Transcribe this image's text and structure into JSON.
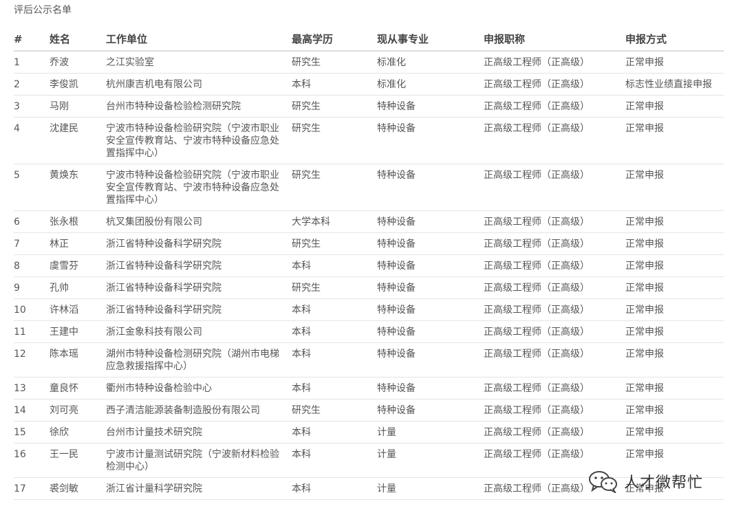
{
  "title": "评后公示名单",
  "columns": [
    "#",
    "姓名",
    "工作单位",
    "最高学历",
    "现从事专业",
    "申报职称",
    "申报方式"
  ],
  "rows": [
    {
      "no": "1",
      "name": "乔波",
      "unit": "之江实验室",
      "edu": "研究生",
      "major": "标准化",
      "title": "正高级工程师（正高级）",
      "method": "正常申报"
    },
    {
      "no": "2",
      "name": "李俊凯",
      "unit": "杭州康吉机电有限公司",
      "edu": "本科",
      "major": "标准化",
      "title": "正高级工程师（正高级）",
      "method": "标志性业绩直接申报"
    },
    {
      "no": "3",
      "name": "马刚",
      "unit": "台州市特种设备检验检测研究院",
      "edu": "研究生",
      "major": "特种设备",
      "title": "正高级工程师（正高级）",
      "method": "正常申报"
    },
    {
      "no": "4",
      "name": "沈建民",
      "unit": "宁波市特种设备检验研究院（宁波市职业安全宣传教育站、宁波市特种设备应急处置指挥中心）",
      "edu": "研究生",
      "major": "特种设备",
      "title": "正高级工程师（正高级）",
      "method": "正常申报"
    },
    {
      "no": "5",
      "name": "黄焕东",
      "unit": "宁波市特种设备检验研究院（宁波市职业安全宣传教育站、宁波市特种设备应急处置指挥中心）",
      "edu": "研究生",
      "major": "特种设备",
      "title": "正高级工程师（正高级）",
      "method": "正常申报"
    },
    {
      "no": "6",
      "name": "张永根",
      "unit": "杭叉集团股份有限公司",
      "edu": "大学本科",
      "major": "特种设备",
      "title": "正高级工程师（正高级）",
      "method": "正常申报"
    },
    {
      "no": "7",
      "name": "林正",
      "unit": "浙江省特种设备科学研究院",
      "edu": "研究生",
      "major": "特种设备",
      "title": "正高级工程师（正高级）",
      "method": "正常申报"
    },
    {
      "no": "8",
      "name": "虞雪芬",
      "unit": "浙江省特种设备科学研究院",
      "edu": "本科",
      "major": "特种设备",
      "title": "正高级工程师（正高级）",
      "method": "正常申报"
    },
    {
      "no": "9",
      "name": "孔帅",
      "unit": "浙江省特种设备科学研究院",
      "edu": "研究生",
      "major": "特种设备",
      "title": "正高级工程师（正高级）",
      "method": "正常申报"
    },
    {
      "no": "10",
      "name": "许林滔",
      "unit": "浙江省特种设备科学研究院",
      "edu": "本科",
      "major": "特种设备",
      "title": "正高级工程师（正高级）",
      "method": "正常申报"
    },
    {
      "no": "11",
      "name": "王建中",
      "unit": "浙江金象科技有限公司",
      "edu": "本科",
      "major": "特种设备",
      "title": "正高级工程师（正高级）",
      "method": "正常申报"
    },
    {
      "no": "12",
      "name": "陈本瑶",
      "unit": "湖州市特种设备检测研究院（湖州市电梯应急救援指挥中心）",
      "edu": "本科",
      "major": "特种设备",
      "title": "正高级工程师（正高级）",
      "method": "正常申报"
    },
    {
      "no": "13",
      "name": "童良怀",
      "unit": "衢州市特种设备检验中心",
      "edu": "本科",
      "major": "特种设备",
      "title": "正高级工程师（正高级）",
      "method": "正常申报"
    },
    {
      "no": "14",
      "name": "刘可亮",
      "unit": "西子清洁能源装备制造股份有限公司",
      "edu": "研究生",
      "major": "特种设备",
      "title": "正高级工程师（正高级）",
      "method": "正常申报"
    },
    {
      "no": "15",
      "name": "徐欣",
      "unit": "台州市计量技术研究院",
      "edu": "本科",
      "major": "计量",
      "title": "正高级工程师（正高级）",
      "method": "正常申报"
    },
    {
      "no": "16",
      "name": "王一民",
      "unit": "宁波市计量测试研究院（宁波新材料检验检测中心）",
      "edu": "本科",
      "major": "计量",
      "title": "正高级工程师（正高级）",
      "method": "正常申报"
    },
    {
      "no": "17",
      "name": "裘剑敏",
      "unit": "浙江省计量科学研究院",
      "edu": "本科",
      "major": "计量",
      "title": "正高级工程师（正高级）",
      "method": "正常申报"
    }
  ],
  "watermark": {
    "text": "人才微帮忙",
    "icon": "wechat-icon"
  }
}
